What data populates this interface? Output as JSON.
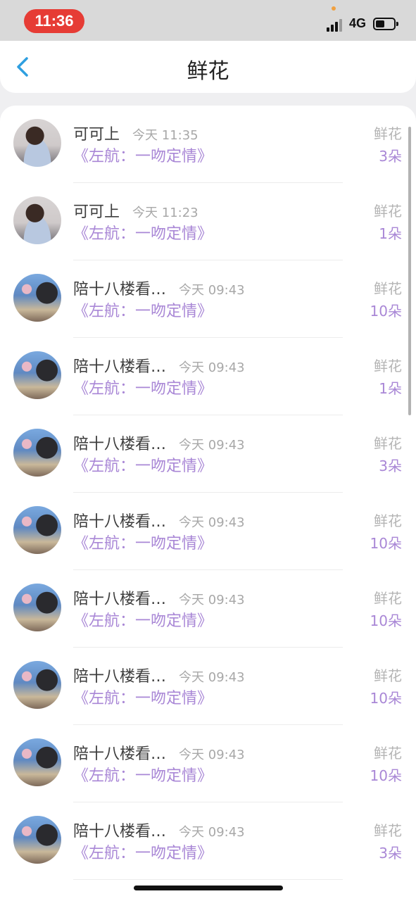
{
  "status_bar": {
    "time": "11:36",
    "network": "4G",
    "battery_level": 0.5,
    "signal_bars": 3,
    "colors": {
      "time_pill": "#e63c35"
    }
  },
  "header": {
    "title": "鲜花",
    "back_icon": "chevron-left-icon"
  },
  "colors": {
    "accent_purple": "#a987d6",
    "back_blue": "#2f9fe0"
  },
  "rows": [
    {
      "name": "可可上",
      "time": "今天 11:35",
      "book": "《左航：一吻定情》",
      "type": "鲜花",
      "count": "3朵",
      "avatar": "avatar-a"
    },
    {
      "name": "可可上",
      "time": "今天 11:23",
      "book": "《左航：一吻定情》",
      "type": "鲜花",
      "count": "1朵",
      "avatar": "avatar-a"
    },
    {
      "name": "陪十八楼看…",
      "time": "今天 09:43",
      "book": "《左航：一吻定情》",
      "type": "鲜花",
      "count": "10朵",
      "avatar": "avatar-b"
    },
    {
      "name": "陪十八楼看…",
      "time": "今天 09:43",
      "book": "《左航：一吻定情》",
      "type": "鲜花",
      "count": "1朵",
      "avatar": "avatar-b"
    },
    {
      "name": "陪十八楼看…",
      "time": "今天 09:43",
      "book": "《左航：一吻定情》",
      "type": "鲜花",
      "count": "3朵",
      "avatar": "avatar-b"
    },
    {
      "name": "陪十八楼看…",
      "time": "今天 09:43",
      "book": "《左航：一吻定情》",
      "type": "鲜花",
      "count": "10朵",
      "avatar": "avatar-b"
    },
    {
      "name": "陪十八楼看…",
      "time": "今天 09:43",
      "book": "《左航：一吻定情》",
      "type": "鲜花",
      "count": "10朵",
      "avatar": "avatar-b"
    },
    {
      "name": "陪十八楼看…",
      "time": "今天 09:43",
      "book": "《左航：一吻定情》",
      "type": "鲜花",
      "count": "10朵",
      "avatar": "avatar-b"
    },
    {
      "name": "陪十八楼看…",
      "time": "今天 09:43",
      "book": "《左航：一吻定情》",
      "type": "鲜花",
      "count": "10朵",
      "avatar": "avatar-b"
    },
    {
      "name": "陪十八楼看…",
      "time": "今天 09:43",
      "book": "《左航：一吻定情》",
      "type": "鲜花",
      "count": "3朵",
      "avatar": "avatar-b"
    }
  ]
}
